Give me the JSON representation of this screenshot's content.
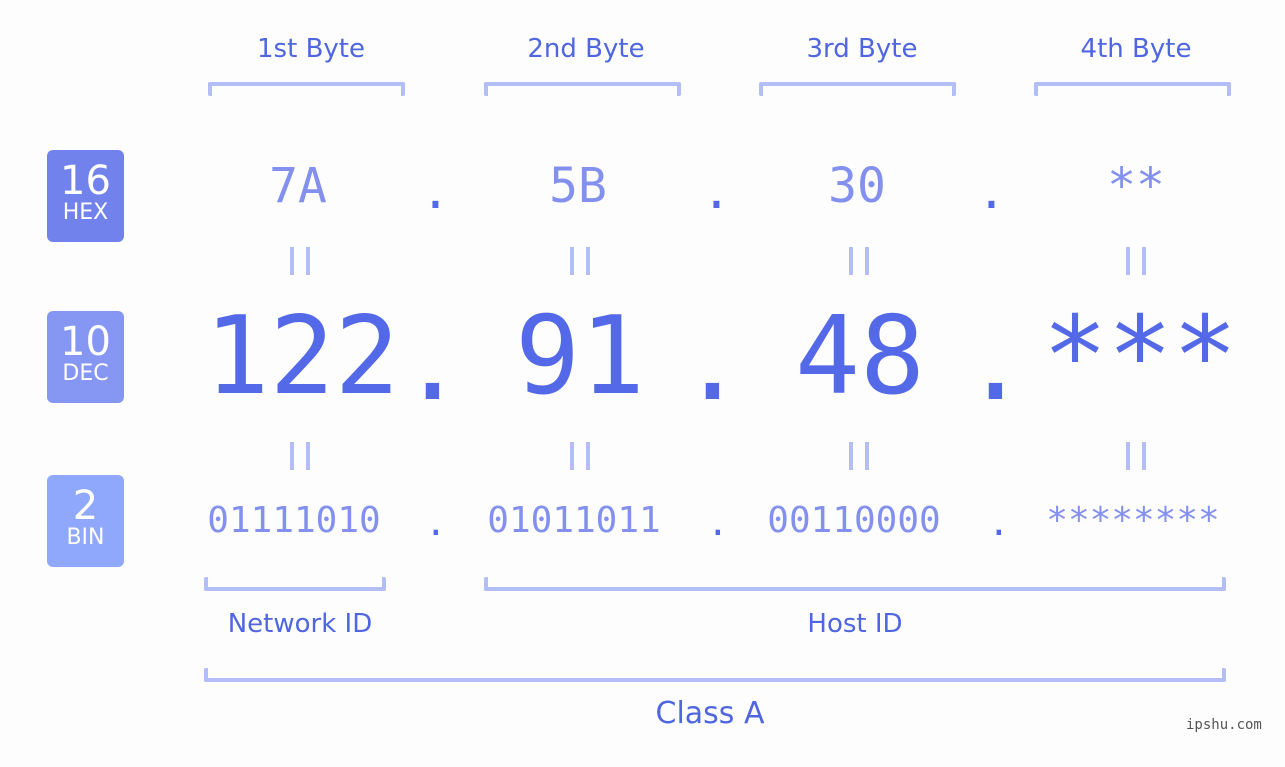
{
  "byte_headers": [
    "1st Byte",
    "2nd Byte",
    "3rd Byte",
    "4th Byte"
  ],
  "rows": {
    "hex": {
      "base": "16",
      "label": "HEX",
      "values": [
        "7A",
        "5B",
        "30",
        "**"
      ],
      "color": "#7282ec"
    },
    "dec": {
      "base": "10",
      "label": "DEC",
      "values": [
        "122",
        "91",
        "48",
        "***"
      ],
      "color": "#8596f3"
    },
    "bin": {
      "base": "2",
      "label": "BIN",
      "values": [
        "01111010",
        "01011011",
        "00110000",
        "********"
      ],
      "color": "#90a8fb"
    }
  },
  "separator": ".",
  "equals": "=",
  "network_label": "Network ID",
  "host_label": "Host ID",
  "class_label": "Class A",
  "watermark": "ipshu.com",
  "colors": {
    "accent": "#4f66e0",
    "bracket": "#b3bdf6",
    "value_light": "#8390ee",
    "value_dark": "#5369e8"
  }
}
